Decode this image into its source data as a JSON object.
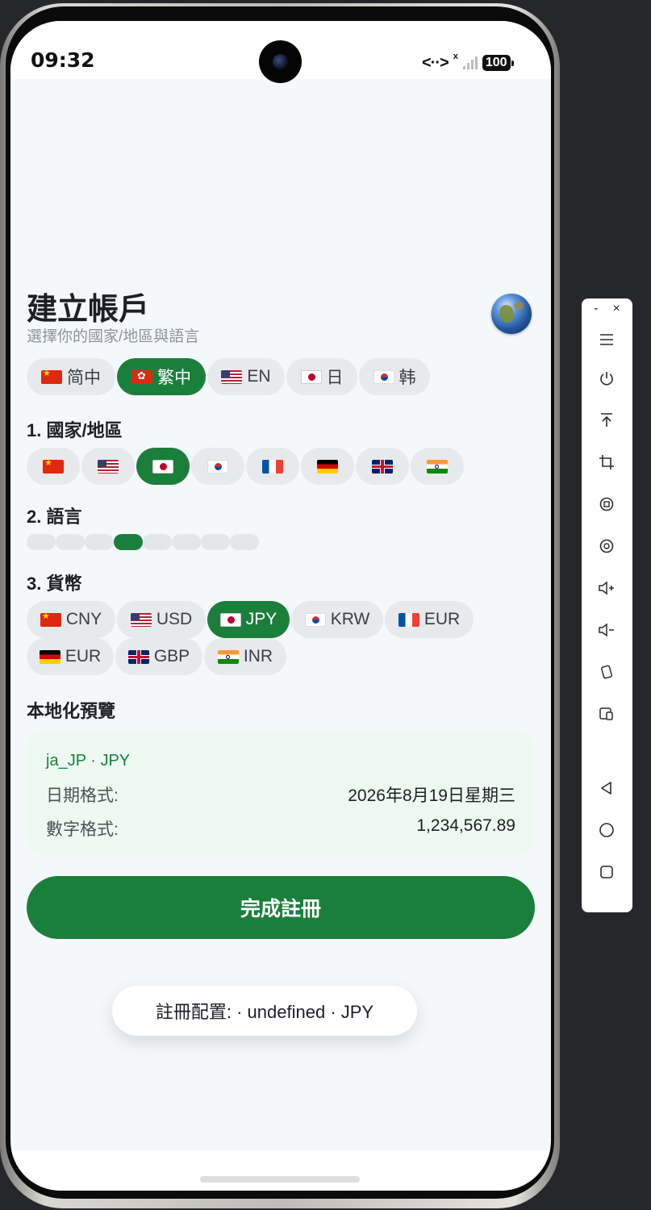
{
  "status_bar": {
    "time": "09:32",
    "net_icon": "<··>",
    "signal_x": "x",
    "battery": "100"
  },
  "header": {
    "title": "建立帳戶",
    "subtitle": "選擇你的國家/地區與語言",
    "globe_icon": "globe-icon"
  },
  "ui_language_tabs": [
    {
      "flag": "cn",
      "label": "简中",
      "active": false
    },
    {
      "flag": "hk",
      "label": "繁中",
      "active": true
    },
    {
      "flag": "us",
      "label": "EN",
      "active": false
    },
    {
      "flag": "jp",
      "label": "日",
      "active": false
    },
    {
      "flag": "kr",
      "label": "韩",
      "active": false
    }
  ],
  "country_section": {
    "title": "1. 國家/地區",
    "items": [
      {
        "flag": "cn",
        "active": false
      },
      {
        "flag": "us",
        "active": false
      },
      {
        "flag": "jp",
        "active": true
      },
      {
        "flag": "kr",
        "active": false
      },
      {
        "flag": "fr",
        "active": false
      },
      {
        "flag": "de",
        "active": false
      },
      {
        "flag": "gb",
        "active": false
      },
      {
        "flag": "in",
        "active": false
      }
    ]
  },
  "language_section": {
    "title": "2. 語言",
    "dots": [
      false,
      false,
      false,
      true,
      false,
      false,
      false,
      false
    ]
  },
  "currency_section": {
    "title": "3. 貨幣",
    "items": [
      {
        "flag": "cn",
        "label": "CNY",
        "active": false
      },
      {
        "flag": "us",
        "label": "USD",
        "active": false
      },
      {
        "flag": "jp",
        "label": "JPY",
        "active": true
      },
      {
        "flag": "kr",
        "label": "KRW",
        "active": false
      },
      {
        "flag": "fr",
        "label": "EUR",
        "active": false
      },
      {
        "flag": "de",
        "label": "EUR",
        "active": false
      },
      {
        "flag": "gb",
        "label": "GBP",
        "active": false
      },
      {
        "flag": "in",
        "label": "INR",
        "active": false
      }
    ]
  },
  "preview": {
    "title": "本地化預覽",
    "locale": "ja_JP · JPY",
    "date_label": "日期格式:",
    "date_value": "2026年8月19日星期三",
    "number_label": "數字格式:",
    "number_value": "1,234,567.89"
  },
  "submit_label": "完成註冊",
  "toast": "註冊配置: · undefined · JPY",
  "emulator_toolbar": {
    "minimize": "-",
    "close": "×",
    "icons": [
      "menu-icon",
      "power-icon",
      "pin-top-icon",
      "crop-icon",
      "rotate-ccw-icon",
      "rotate-cw-icon",
      "volume-up-icon",
      "volume-down-icon",
      "shake-icon",
      "multi-display-icon",
      "back-icon",
      "home-icon",
      "recents-icon"
    ]
  }
}
